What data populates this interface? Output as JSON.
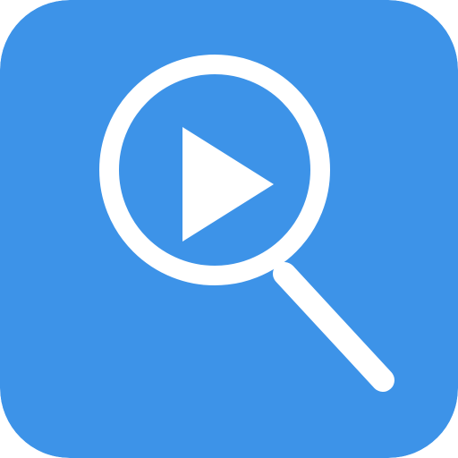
{
  "icon": {
    "name": "video-search-app-icon",
    "glyphs": [
      "magnifying-glass-icon",
      "play-icon"
    ],
    "colors": {
      "background": "#3d93e8",
      "glyph": "#ffffff"
    }
  }
}
